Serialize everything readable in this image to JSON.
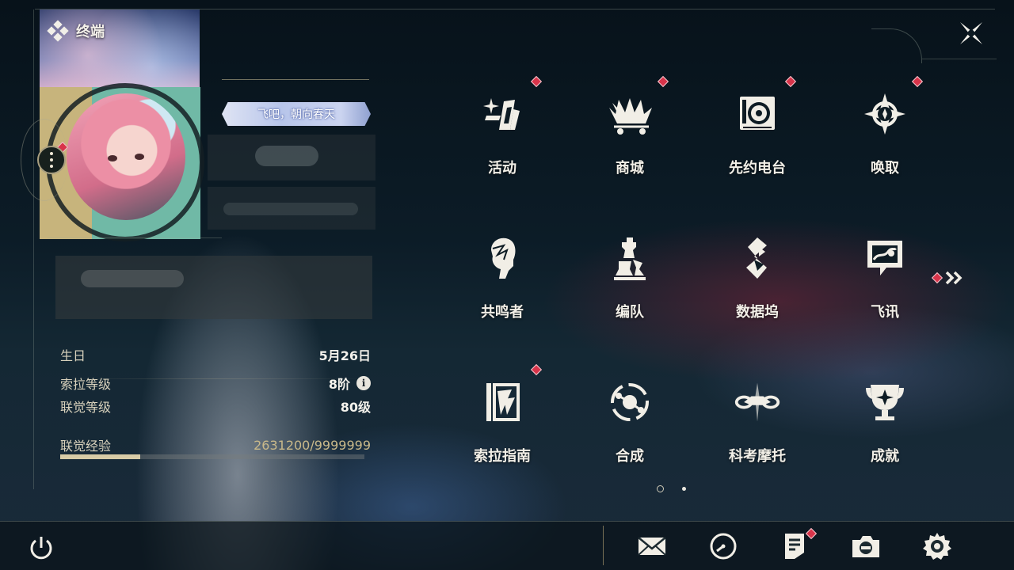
{
  "header": {
    "title": "终端",
    "title_icon": "terminal-diamond-icon",
    "close_icon": "close-x-icon"
  },
  "profile": {
    "signature_banner": "飞吧，朝向春天",
    "more_icon": "more-dots-icon",
    "stats": {
      "birthday_label": "生日",
      "birthday_value": "5月26日",
      "sola_level_label": "索拉等级",
      "sola_level_value": "8阶",
      "union_level_label": "联觉等级",
      "union_level_value": "80级",
      "union_exp_label": "联觉经验",
      "union_exp_value": "2631200/9999999",
      "union_exp_fraction": 0.2631
    },
    "info_glyph": "i"
  },
  "menu": {
    "items": [
      {
        "label": "活动",
        "icon": "events-icon",
        "badge": true
      },
      {
        "label": "商城",
        "icon": "shop-cart-icon",
        "badge": true
      },
      {
        "label": "先约电台",
        "icon": "radio-icon",
        "badge": true
      },
      {
        "label": "唤取",
        "icon": "convene-star-icon",
        "badge": true
      },
      {
        "label": "共鸣者",
        "icon": "resonator-head-icon",
        "badge": false
      },
      {
        "label": "编队",
        "icon": "chess-team-icon",
        "badge": false
      },
      {
        "label": "数据坞",
        "icon": "data-bank-icon",
        "badge": false
      },
      {
        "label": "飞讯",
        "icon": "message-chat-icon",
        "badge": false
      },
      {
        "label": "索拉指南",
        "icon": "guidebook-icon",
        "badge": true
      },
      {
        "label": "合成",
        "icon": "synthesis-icon",
        "badge": false
      },
      {
        "label": "科考摩托",
        "icon": "motorbike-icon",
        "badge": false
      },
      {
        "label": "成就",
        "icon": "trophy-icon",
        "badge": false
      }
    ],
    "next_page_icon": "double-chevron-right-icon",
    "page_indicator": {
      "current": 1,
      "total": 2
    }
  },
  "bottom_bar": {
    "power_icon": "power-icon",
    "tools": [
      "mail-icon",
      "clock-icon",
      "notice-icon",
      "camera-icon",
      "settings-gear-icon"
    ]
  },
  "colors": {
    "accent_gold": "#c9b98a",
    "badge_red": "#d8344a",
    "text_primary": "#f2efe7"
  }
}
